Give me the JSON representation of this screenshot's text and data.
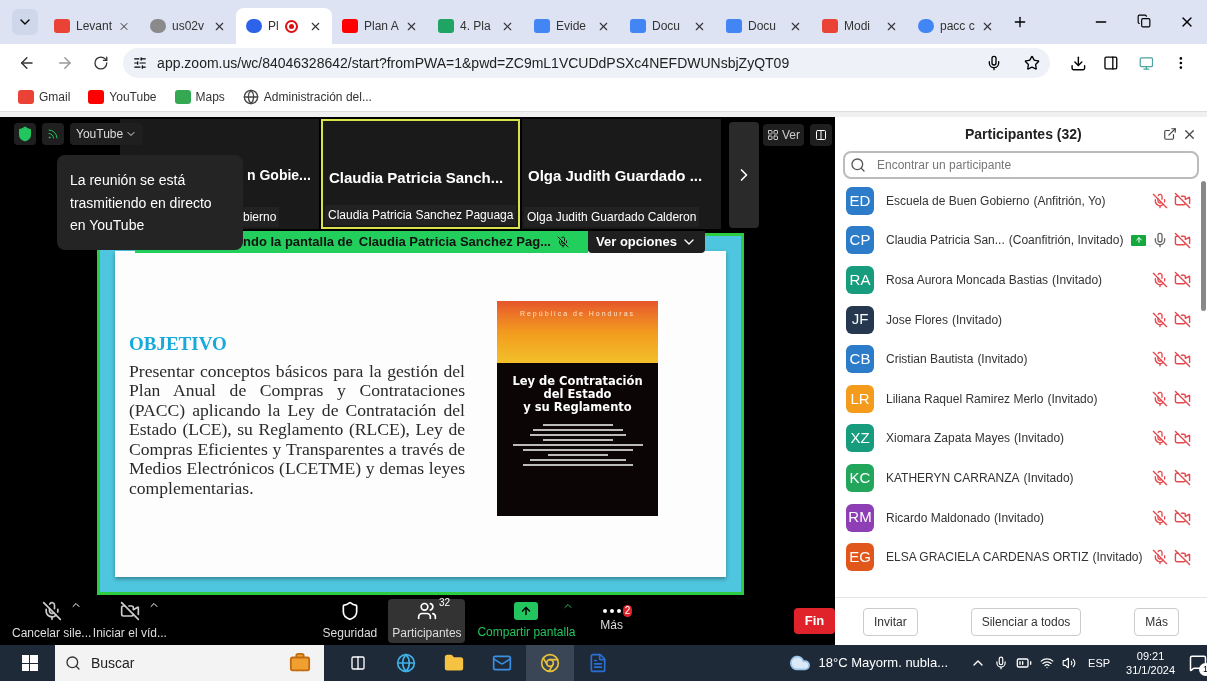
{
  "browser": {
    "tabs": [
      {
        "label": "Levant",
        "selected": false,
        "recording": false
      },
      {
        "label": "us02v",
        "selected": false,
        "recording": false
      },
      {
        "label": "Pl",
        "selected": true,
        "recording": true
      },
      {
        "label": "Plan A",
        "selected": false,
        "recording": false
      },
      {
        "label": "4. Pla",
        "selected": false,
        "recording": false
      },
      {
        "label": "Evide",
        "selected": false,
        "recording": false
      },
      {
        "label": "Docu",
        "selected": false,
        "recording": false
      },
      {
        "label": "Docu",
        "selected": false,
        "recording": false
      },
      {
        "label": "Modi",
        "selected": false,
        "recording": false
      },
      {
        "label": "pacc c",
        "selected": false,
        "recording": false
      }
    ],
    "url": "app.zoom.us/wc/84046328642/start?fromPWA=1&pwd=ZC9mL1VCUDdPSXc4NEFDWUNsbjZyQT09",
    "bookmarks": [
      {
        "label": "Gmail"
      },
      {
        "label": "YouTube"
      },
      {
        "label": "Maps"
      },
      {
        "label": "Administración del..."
      }
    ]
  },
  "meeting": {
    "live_label": "YouTube",
    "view_label": "Ver",
    "tooltip": "La reunión se está trasmitiendo en directo en YouTube",
    "thumbnails": [
      {
        "title": "n Gobie...",
        "label": "bierno",
        "active": false
      },
      {
        "title": "Claudia Patricia Sanch...",
        "label": "Claudia Patricia Sanchez Paguaga",
        "active": true
      },
      {
        "title": "Olga Judith Guardado ...",
        "label": "Olga Judith Guardado Calderon",
        "active": false
      }
    ],
    "share_banner": {
      "prefix": "ndo la pantalla de",
      "name": "Claudia Patricia Sanchez Pag...",
      "options": "Ver opciones"
    },
    "slide": {
      "heading": "OBJETIVO",
      "body": "Presentar conceptos básicos para la gestión del Plan Anual de Compras y Contrataciones (PACC) aplicando la Ley de Contratación del Estado (LCE), su Reglamento (RLCE), Ley de Compras Eficientes y Transparentes a través de Medios Electrónicos (LCETME) y demas leyes complementarias.",
      "cover": {
        "top": "República de Honduras",
        "title": [
          "Ley de Contratación",
          "del Estado",
          "y su Reglamento"
        ]
      }
    },
    "toolbar": [
      {
        "kind": "mic",
        "label": "Cancelar sile...",
        "caret": true,
        "selected": false
      },
      {
        "kind": "video",
        "label": "Iniciar el víd...",
        "caret": true,
        "selected": false
      },
      {
        "kind": "security",
        "label": "Seguridad",
        "caret": false,
        "selected": false
      },
      {
        "kind": "participants",
        "label": "Participantes",
        "caret": false,
        "selected": true,
        "badge": "32"
      },
      {
        "kind": "share",
        "label": "Compartir pantalla",
        "caret": true,
        "selected": false
      },
      {
        "kind": "more",
        "label": "Más",
        "caret": false,
        "selected": false,
        "badge": "2"
      }
    ],
    "end_label": "Fin"
  },
  "participants_panel": {
    "title": "Participantes (32)",
    "search_placeholder": "Encontrar un participante",
    "people": [
      {
        "initials": "ED",
        "color": "#2d7cc9",
        "name": "Escuela de Buen Gobierno",
        "role": "(Anfitrión, Yo)",
        "muted": true,
        "video_off": true,
        "sharing": false
      },
      {
        "initials": "CP",
        "color": "#2d7cc9",
        "name": "Claudia Patricia San...",
        "role": "(Coanfitrión, Invitado)",
        "muted": false,
        "video_off": true,
        "sharing": true
      },
      {
        "initials": "RA",
        "color": "#179c7e",
        "name": "Rosa Aurora Moncada Bastias",
        "role": "(Invitado)",
        "muted": true,
        "video_off": true,
        "sharing": false
      },
      {
        "initials": "JF",
        "color": "#263850",
        "name": "Jose Flores",
        "role": "(Invitado)",
        "muted": true,
        "video_off": true,
        "sharing": false
      },
      {
        "initials": "CB",
        "color": "#2d7cc9",
        "name": "Cristian Bautista",
        "role": "(Invitado)",
        "muted": true,
        "video_off": true,
        "sharing": false
      },
      {
        "initials": "LR",
        "color": "#f59b1b",
        "name": "Liliana Raquel Ramirez Merlo",
        "role": "(Invitado)",
        "muted": true,
        "video_off": true,
        "sharing": false
      },
      {
        "initials": "XZ",
        "color": "#179c7e",
        "name": "Xiomara Zapata Mayes",
        "role": "(Invitado)",
        "muted": true,
        "video_off": true,
        "sharing": false
      },
      {
        "initials": "KC",
        "color": "#21a65c",
        "name": "KATHERYN CARRANZA",
        "role": "(Invitado)",
        "muted": true,
        "video_off": true,
        "sharing": false
      },
      {
        "initials": "RM",
        "color": "#8e3fb5",
        "name": "Ricardo Maldonado",
        "role": "(Invitado)",
        "muted": true,
        "video_off": true,
        "sharing": false
      },
      {
        "initials": "EG",
        "color": "#e0561b",
        "name": "ELSA GRACIELA CARDENAS ORTIZ",
        "role": "(Invitado)",
        "muted": true,
        "video_off": true,
        "sharing": false
      }
    ],
    "buttons": [
      "Invitar",
      "Silenciar a todos",
      "Más"
    ]
  },
  "taskbar": {
    "search": "Buscar",
    "weather": "18°C Mayorm. nubla...",
    "language": "ESP",
    "time": "09:21",
    "date": "31/1/2024",
    "notifications": "1"
  }
}
